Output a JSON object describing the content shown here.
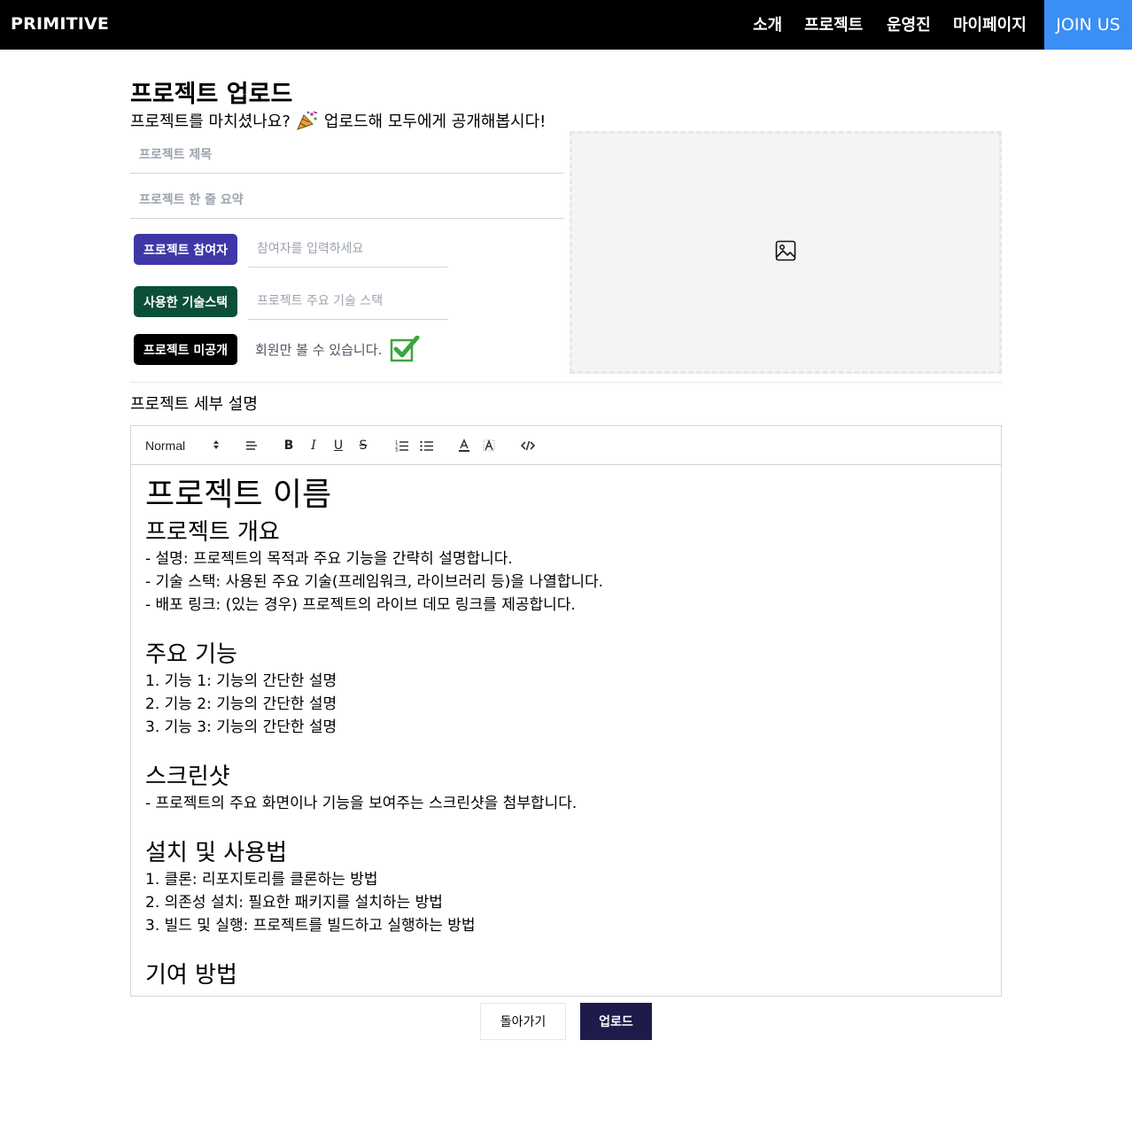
{
  "navbar": {
    "brand": "PRIMITIVE",
    "items": [
      "소개",
      "프로젝트",
      "운영진",
      "마이페이지"
    ],
    "join_label": "JOIN US",
    "join_color": "#3b8ef3"
  },
  "header": {
    "title": "프로젝트 업로드",
    "subtitle_before": "프로젝트를 마치셨나요?",
    "subtitle_icon": "party-popper-icon",
    "subtitle_after": "업로드해 모두에게 공개해봅시다!"
  },
  "form": {
    "title_placeholder": "프로젝트 제목",
    "summary_placeholder": "프로젝트 한 줄 요약",
    "participants_label": "프로젝트 참여자",
    "participants_placeholder": "참여자를 입력하세요",
    "tech_label": "사용한 기술스택",
    "tech_placeholder": "프로젝트 주요 기술 스택",
    "private_label": "프로젝트 미공개",
    "private_note": "회원만 볼 수 있습니다.",
    "private_checked": true,
    "image_icon": "image-icon"
  },
  "detail": {
    "label": "프로젝트 세부 설명",
    "toolbar": {
      "format_select": "Normal",
      "icons": [
        "align-icon",
        "bold-icon",
        "italic-icon",
        "underline-icon",
        "strike-icon",
        "ordered-list-icon",
        "bullet-list-icon",
        "text-color-icon",
        "background-color-icon",
        "code-icon"
      ]
    },
    "content": {
      "h1": "프로젝트 이름",
      "overview_title": "프로젝트 개요",
      "overview_lines": [
        "- 설명: 프로젝트의 목적과 주요 기능을 간략히 설명합니다.",
        "- 기술 스택: 사용된 주요 기술(프레임워크, 라이브러리 등)을 나열합니다.",
        "- 배포 링크: (있는 경우) 프로젝트의 라이브 데모 링크를 제공합니다."
      ],
      "features_title": "주요 기능",
      "features_lines": [
        "1. 기능 1: 기능의 간단한 설명",
        "2. 기능 2: 기능의 간단한 설명",
        "3. 기능 3: 기능의 간단한 설명"
      ],
      "screenshot_title": "스크린샷",
      "screenshot_lines": [
        "- 프로젝트의 주요 화면이나 기능을 보여주는 스크린샷을 첨부합니다."
      ],
      "install_title": "설치 및 사용법",
      "install_lines": [
        "1. 클론: 리포지토리를 클론하는 방법",
        "2. 의존성 설치: 필요한 패키지를 설치하는 방법",
        "3. 빌드 및 실행: 프로젝트를 빌드하고 실행하는 방법"
      ],
      "contrib_title": "기여 방법"
    }
  },
  "actions": {
    "back_label": "돌아가기",
    "upload_label": "업로드"
  }
}
